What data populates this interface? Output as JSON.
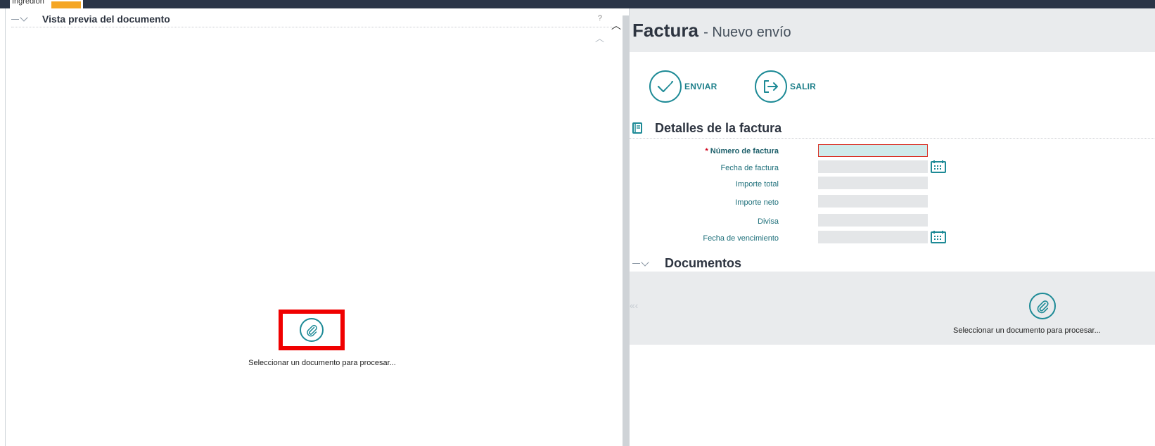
{
  "topbar": {
    "tab_label": "Ingredion"
  },
  "left_panel": {
    "title": "Vista previa del documento",
    "help": "?",
    "select_text": "Seleccionar un documento para procesar..."
  },
  "header": {
    "title": "Factura",
    "subtitle": "- Nuevo envío"
  },
  "actions": {
    "send_label": "ENVIAR",
    "exit_label": "SALIR"
  },
  "details": {
    "title": "Detalles de la factura",
    "fields": [
      {
        "label": "Número de factura",
        "required": true,
        "value": ""
      },
      {
        "label": "Fecha de factura",
        "required": false,
        "value": ""
      },
      {
        "label": "Importe total",
        "required": false,
        "value": ""
      },
      {
        "label": "Importe neto",
        "required": false,
        "value": ""
      },
      {
        "label": "Divisa",
        "required": false,
        "value": ""
      },
      {
        "label": "Fecha de vencimiento",
        "required": false,
        "value": ""
      }
    ],
    "required_mark": "*"
  },
  "documents": {
    "title": "Documentos",
    "nav": "« ‹",
    "select_text": "Seleccionar un documento para procesar..."
  },
  "colors": {
    "accent": "#1d8a96",
    "highlight": "#f00000",
    "topbar": "#2a3547"
  }
}
